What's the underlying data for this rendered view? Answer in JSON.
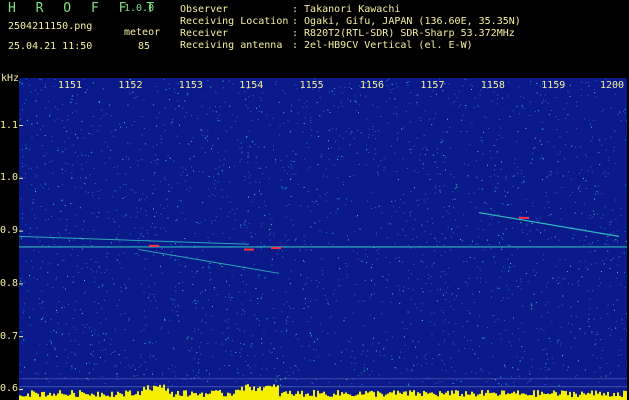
{
  "header": {
    "app_title": "H R O F F T",
    "app_version": "1.0.0",
    "filename": "2504211150.png",
    "datetime": "25.04.21 11:50",
    "meteor_label": "meteor",
    "meteor_count": "85"
  },
  "info": [
    {
      "key": "Observer",
      "value": ": Takanori Kawachi"
    },
    {
      "key": "Receiving Location",
      "value": ": Ogaki, Gifu, JAPAN (136.60E, 35.35N)"
    },
    {
      "key": "Receiver",
      "value": ": R820T2(RTL-SDR) SDR-Sharp 53.372MHz"
    },
    {
      "key": "Receiving antenna",
      "value": ": 2el-HB9CV Vertical (el. E-W)"
    }
  ],
  "chart_data": {
    "type": "heatmap",
    "ylabel": "kHz",
    "y_ticks": [
      "1.1",
      "1.0",
      "0.9",
      "0.8",
      "0.7",
      "0.6"
    ],
    "x_ticks": [
      "1151",
      "1152",
      "1153",
      "1154",
      "1155",
      "1156",
      "1157",
      "1158",
      "1159",
      "1200"
    ],
    "ylim": [
      0.58,
      1.19
    ],
    "xlim": [
      1150.5,
      1200
    ],
    "colors": {
      "background": "#0a1a8a",
      "noise": "#2a6bd8",
      "signal": "#38e0c8",
      "peak": "#ff3040",
      "level": "#f5ef00"
    }
  }
}
